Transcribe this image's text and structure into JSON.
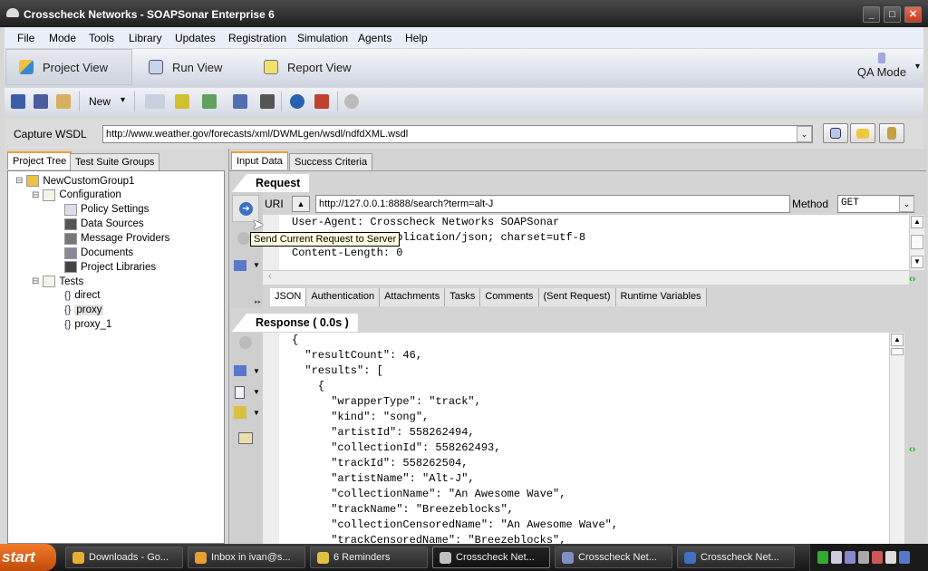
{
  "window": {
    "title": "Crosscheck Networks - SOAPSonar Enterprise 6",
    "minimize": "_",
    "maximize": "□",
    "close": "✕"
  },
  "menu": [
    "File",
    "Mode",
    "Tools",
    "Library",
    "Updates",
    "Registration",
    "Simulation",
    "Agents",
    "Help"
  ],
  "views": [
    {
      "label": "Project View",
      "icon": "project-view-icon",
      "selected": true
    },
    {
      "label": "Run View",
      "icon": "run-view-icon"
    },
    {
      "label": "Report View",
      "icon": "report-view-icon"
    }
  ],
  "qa_mode": {
    "label": "QA Mode",
    "arrow": "▾"
  },
  "toolbar": {
    "new_label": "New",
    "new_arrow": "▾"
  },
  "wsdl": {
    "label": "Capture WSDL",
    "value": "http://www.weather.gov/forecasts/xml/DWMLgen/wsdl/ndfdXML.wsdl",
    "arrow": "⌄"
  },
  "left_tabs": [
    "Project Tree",
    "Test Suite Groups"
  ],
  "tree": [
    {
      "label": "NewCustomGroup1",
      "level": 0,
      "icon": "group-icon",
      "expander": "⊟"
    },
    {
      "label": "Configuration",
      "level": 1,
      "icon": "folder-icon",
      "expander": "⊟"
    },
    {
      "label": "Policy Settings",
      "level": 2,
      "icon": "policy-icon"
    },
    {
      "label": "Data Sources",
      "level": 2,
      "icon": "data-sources-icon"
    },
    {
      "label": "Message Providers",
      "level": 2,
      "icon": "message-providers-icon"
    },
    {
      "label": "Documents",
      "level": 2,
      "icon": "documents-icon"
    },
    {
      "label": "Project Libraries",
      "level": 2,
      "icon": "libraries-icon"
    },
    {
      "label": "Tests",
      "level": 1,
      "icon": "folder-icon",
      "expander": "⊟"
    },
    {
      "label": "direct",
      "level": 2,
      "icon": "json-test-icon",
      "glyph": "{}"
    },
    {
      "label": "proxy",
      "level": 2,
      "icon": "json-test-icon",
      "glyph": "{}",
      "selected": true
    },
    {
      "label": "proxy_1",
      "level": 2,
      "icon": "json-test-icon",
      "glyph": "{}"
    }
  ],
  "right_tabs": [
    "Input Data",
    "Success Criteria"
  ],
  "request": {
    "header": "Request",
    "uri_label": "URI",
    "uri_value": "http://127.0.0.1:8888/search?term=alt-J",
    "method_label": "Method",
    "method_value": "GET",
    "headers": "User-Agent: Crosscheck Networks SOAPSonar\nContent-Type: application/json; charset=utf-8\nContent-Length: 0",
    "tooltip": "Send Current Request to Server",
    "tabs": [
      "JSON",
      "Authentication",
      "Attachments",
      "Tasks",
      "Comments",
      "(Sent Request)",
      "Runtime Variables"
    ]
  },
  "response": {
    "header": "Response ( 0.0s )",
    "body": "{\n  \"resultCount\": 46,\n  \"results\": [\n    {\n      \"wrapperType\": \"track\",\n      \"kind\": \"song\",\n      \"artistId\": 558262494,\n      \"collectionId\": 558262493,\n      \"trackId\": 558262504,\n      \"artistName\": \"Alt-J\",\n      \"collectionName\": \"An Awesome Wave\",\n      \"trackName\": \"Breezeblocks\",\n      \"collectionCensoredName\": \"An Awesome Wave\",\n      \"trackCensoredName\": \"Breezeblocks\","
  },
  "taskbar": {
    "start": "start",
    "tasks": [
      {
        "label": "Downloads - Go...",
        "color": "#e8b030"
      },
      {
        "label": "Inbox in ivan@s...",
        "color": "#e8a030"
      },
      {
        "label": "6 Reminders",
        "color": "#e0c040"
      },
      {
        "label": "Crosscheck Net...",
        "color": "#c0c0c0",
        "active": true
      },
      {
        "label": "Crosscheck Net...",
        "color": "#8090c0"
      },
      {
        "label": "Crosscheck Net...",
        "color": "#4070c0"
      }
    ]
  },
  "colors": {
    "accent_tab": "#f0a030",
    "titlebar": "#2b2b2b",
    "close_button": "#d8442c"
  }
}
